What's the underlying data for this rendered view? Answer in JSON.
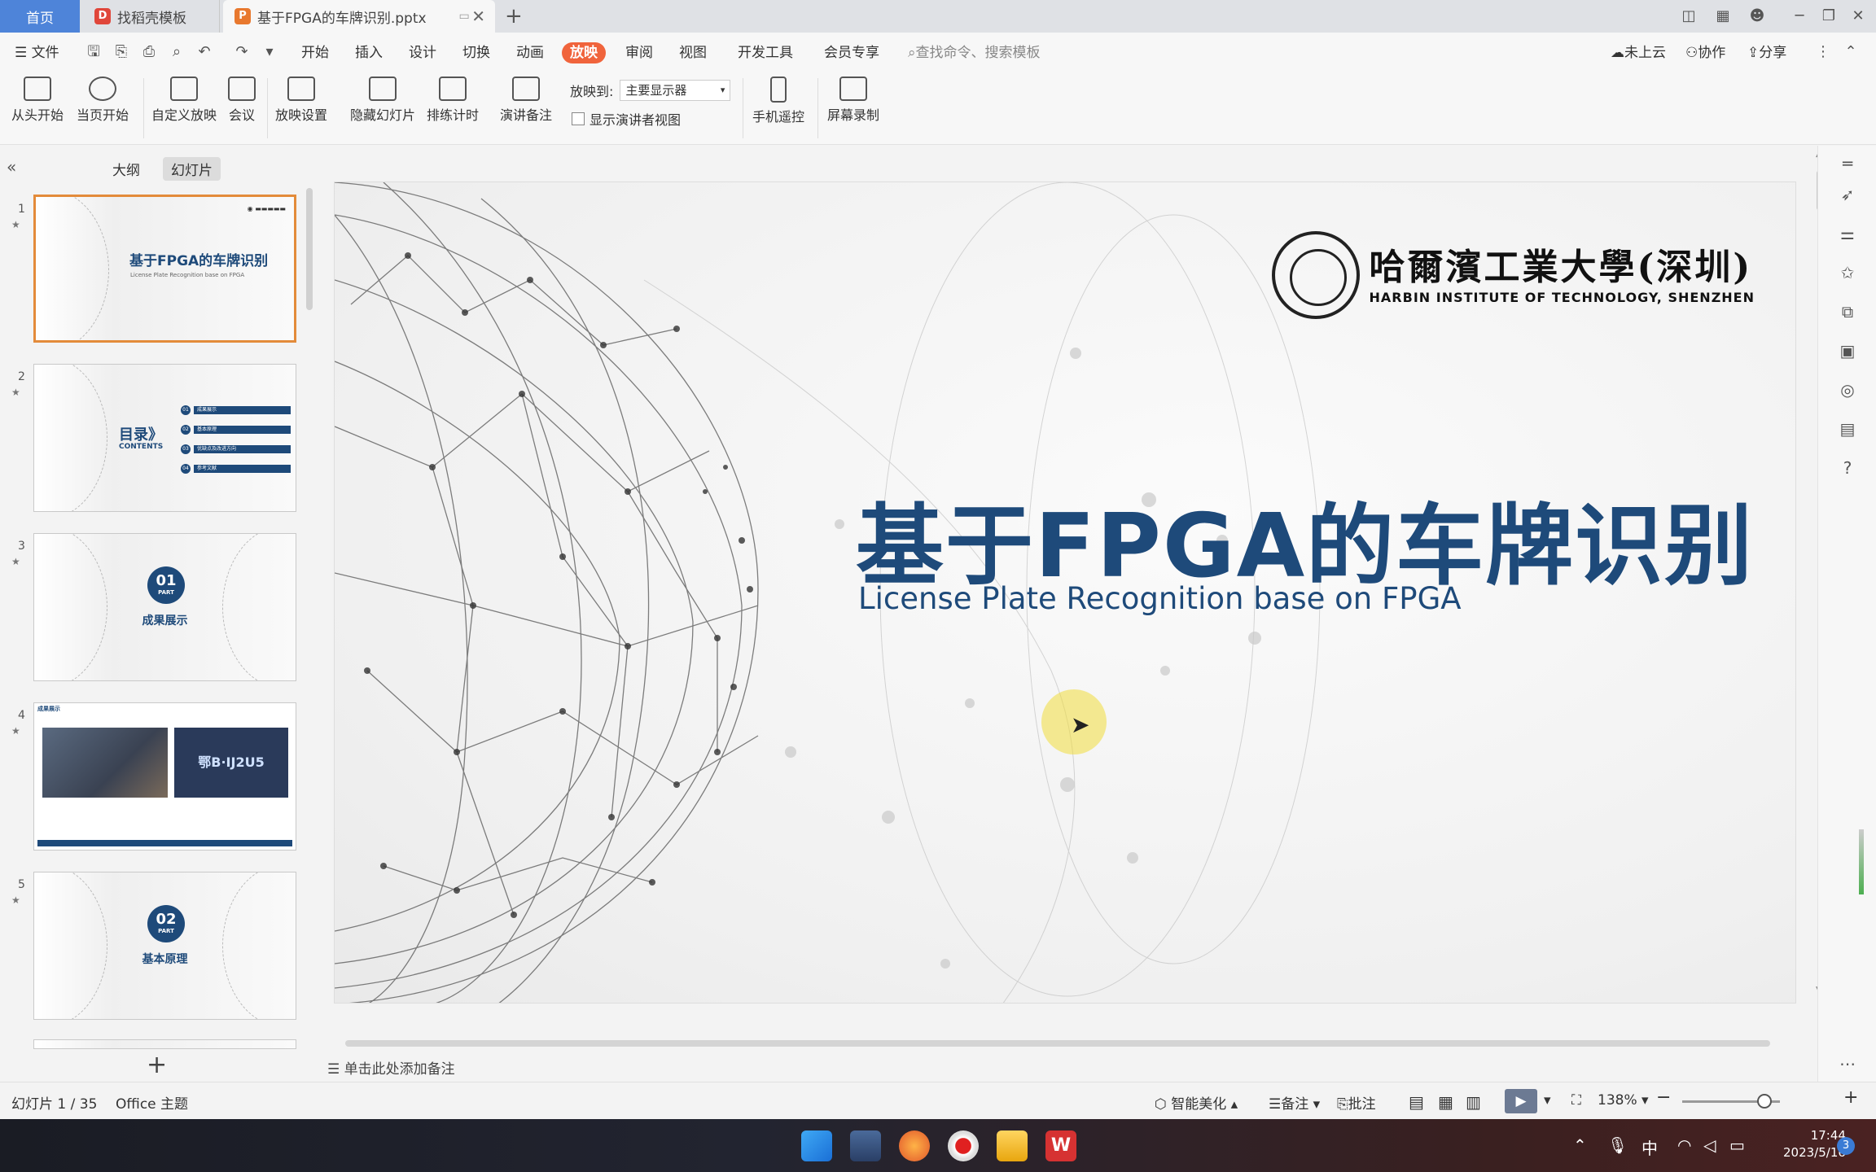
{
  "tabs": {
    "home": "首页",
    "template": "找稻壳模板",
    "file": "基于FPGA的车牌识别.pptx"
  },
  "menu": {
    "file": "文件",
    "items": [
      "开始",
      "插入",
      "设计",
      "切换",
      "动画",
      "放映",
      "审阅",
      "视图",
      "开发工具",
      "会员专享"
    ],
    "search_placeholder": "查找命令、搜索模板",
    "cloud": "未上云",
    "collab": "协作",
    "share": "分享"
  },
  "ribbon": {
    "from_start": "从头开始",
    "from_current": "当页开始",
    "custom_show": "自定义放映",
    "meeting": "会议",
    "show_settings": "放映设置",
    "hide_slide": "隐藏幻灯片",
    "rehearse": "排练计时",
    "speaker_notes": "演讲备注",
    "play_to_label": "放映到:",
    "play_to_value": "主要显示器",
    "presenter_view": "显示演讲者视图",
    "phone_remote": "手机遥控",
    "screen_record": "屏幕录制"
  },
  "panel": {
    "outline_tab": "大纲",
    "slides_tab": "幻灯片",
    "thumbs": [
      {
        "num": "1",
        "title": "基于FPGA的车牌识别",
        "sub": "License Plate Recognition base on FPGA"
      },
      {
        "num": "2",
        "toc_title": "目录》",
        "toc_en": "CONTENTS",
        "toc": [
          "成果展示",
          "基本原理",
          "优缺点及改进方向",
          "参考文献"
        ]
      },
      {
        "num": "3",
        "part": "01",
        "part_word": "PART",
        "label": "成果展示"
      },
      {
        "num": "4",
        "header": "成果展示",
        "plate": "鄂B·IJ2U5"
      },
      {
        "num": "5",
        "part": "02",
        "part_word": "PART",
        "label": "基本原理"
      }
    ]
  },
  "slide": {
    "title": "基于FPGA的车牌识别",
    "subtitle": "License Plate Recognition base on FPGA",
    "logo_cn": "哈爾濱工業大學(深圳)",
    "logo_en": "HARBIN INSTITUTE OF TECHNOLOGY, SHENZHEN"
  },
  "notes_placeholder": "单击此处添加备注",
  "status": {
    "slide_count": "幻灯片 1 / 35",
    "theme": "Office 主题",
    "beautify": "智能美化",
    "notes": "备注",
    "comment": "批注",
    "zoom": "138%"
  },
  "clock": {
    "time": "17:44",
    "date": "2023/5/16"
  },
  "tray": {
    "ime": "中",
    "badge": "3"
  },
  "colors": {
    "accent": "#f0643c",
    "title_blue": "#1e4a7a",
    "tab_blue": "#4e84d9"
  }
}
